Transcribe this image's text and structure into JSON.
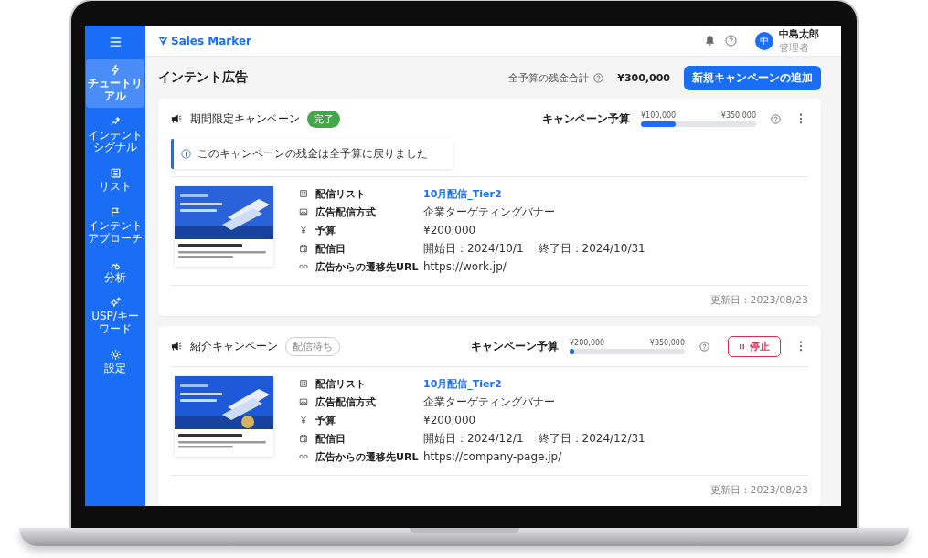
{
  "app": {
    "logo": "Sales Marker"
  },
  "sidebar": {
    "items": [
      {
        "label": "チュートリアル",
        "selected": true
      },
      {
        "label": "インテントシグナル",
        "selected": false
      },
      {
        "label": "リスト",
        "selected": false
      },
      {
        "label": "インテントアプローチ",
        "selected": false
      },
      {
        "label": "分析",
        "selected": false
      },
      {
        "label": "USP/キーワード",
        "selected": false
      },
      {
        "label": "設定",
        "selected": false
      }
    ]
  },
  "user": {
    "initial": "中",
    "name": "中島太郎",
    "role": "管理者"
  },
  "page": {
    "title": "インテント広告",
    "total_label": "全予算の残金合計",
    "total_value": "¥300,000",
    "add_button": "新規キャンペーンの追加"
  },
  "campaigns": [
    {
      "name": "期間限定キャンペーン",
      "status": {
        "label": "完了",
        "kind": "done"
      },
      "budget_label": "キャンペーン予算",
      "budget_used": "¥100,000",
      "budget_total": "¥350,000",
      "level": 0.3,
      "notice": "このキャンペーンの残金は全予算に戻りました",
      "details": [
        {
          "label": "配信リスト",
          "kind": "link",
          "value": "10月配信_Tier2"
        },
        {
          "label": "広告配信方式",
          "kind": "text",
          "value": "企業ターゲティングバナー"
        },
        {
          "label": "予算",
          "kind": "text",
          "value": "¥200,000"
        },
        {
          "label": "配信日",
          "kind": "dates",
          "start": "開始日：2024/10/1",
          "end": "終了日：2024/10/31"
        },
        {
          "label": "広告からの遷移先URL",
          "kind": "text",
          "value": "https://work.jp/"
        }
      ],
      "updated": "更新日：2023/08/23"
    },
    {
      "name": "紹介キャンペーン",
      "status": {
        "label": "配信待ち",
        "kind": "waiting"
      },
      "budget_label": "キャンペーン予算",
      "budget_used": "¥200,000",
      "budget_total": "¥350,000",
      "level": 0.03,
      "stop_button": "停止",
      "details": [
        {
          "label": "配信リスト",
          "kind": "link",
          "value": "10月配信_Tier2"
        },
        {
          "label": "広告配信方式",
          "kind": "text",
          "value": "企業ターゲティングバナー"
        },
        {
          "label": "予算",
          "kind": "text",
          "value": "¥200,000"
        },
        {
          "label": "配信日",
          "kind": "dates",
          "start": "開始日：2024/12/1",
          "end": "終了日：2024/12/31"
        },
        {
          "label": "広告からの遷移先URL",
          "kind": "text",
          "value": "https://company-page.jp/"
        }
      ],
      "updated": "更新日：2023/08/23"
    }
  ]
}
